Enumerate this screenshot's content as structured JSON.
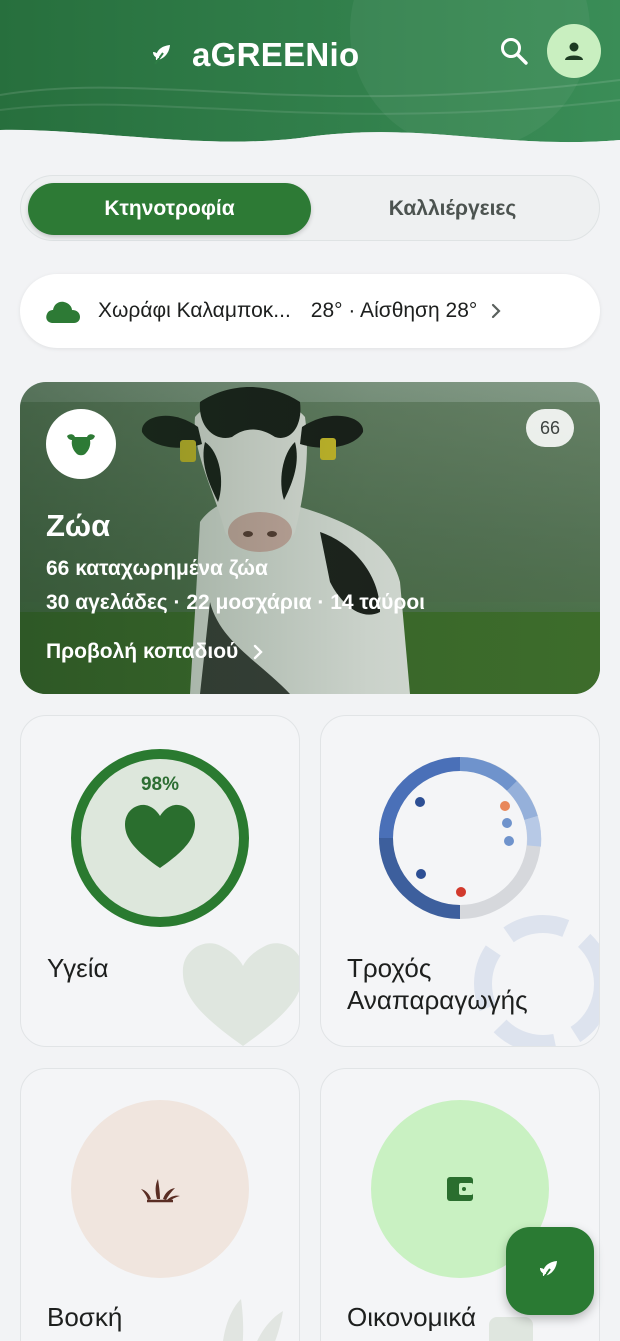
{
  "app": {
    "name": "aGREENio",
    "colors": {
      "primary": "#2d7a35",
      "header": "#2e7d45",
      "accent_light": "#c9efc0"
    }
  },
  "header": {
    "logo_icon": "leaf-sprout-icon",
    "search_icon": "search-icon",
    "avatar_icon": "person-icon"
  },
  "tabs": [
    {
      "label": "Κτηνοτροφία",
      "active": true
    },
    {
      "label": "Καλλιέργειες",
      "active": false
    }
  ],
  "weather": {
    "icon": "cloud-icon",
    "location": "Χωράφι Καλαμποκ...",
    "summary": "28° · Αίσθηση 28°"
  },
  "animals_card": {
    "icon": "cow-head-icon",
    "badge": "66",
    "title": "Ζώα",
    "registered": "66 καταχωρημένα ζώα",
    "breakdown": "30 αγελάδες · 22 μοσχάρια · 14 ταύροι",
    "link": "Προβολή κοπαδιού"
  },
  "feature_cards": {
    "health": {
      "label": "Υγεία",
      "percent_text": "98%",
      "percent_value": 98,
      "icon": "heart-icon"
    },
    "reproduction": {
      "label": "Τροχός Αναπαραγωγής",
      "icon": "cycle-wheel-icon"
    },
    "grazing": {
      "label": "Βοσκή",
      "icon": "grass-icon"
    },
    "finance": {
      "label": "Οικονομικά",
      "icon": "wallet-icon"
    }
  },
  "fab": {
    "icon": "leaf-sprout-icon"
  }
}
